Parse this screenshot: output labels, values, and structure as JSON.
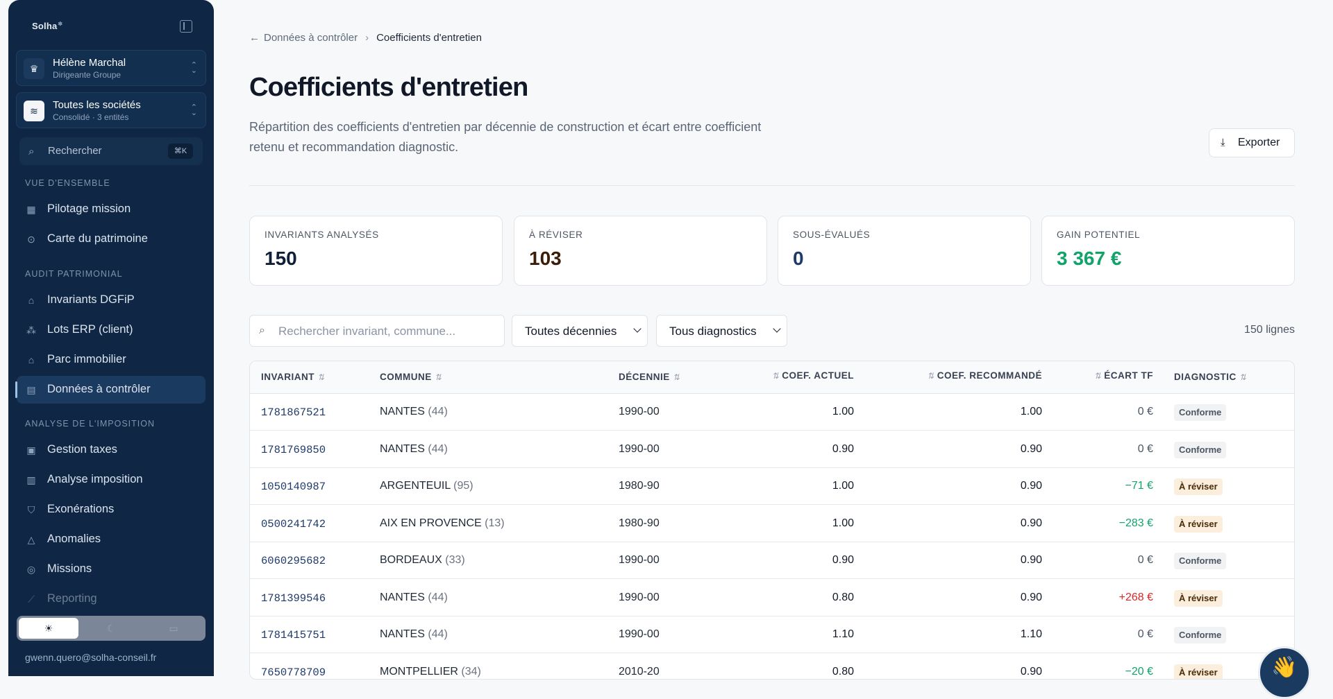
{
  "sidebar": {
    "logo": "Solha",
    "user": {
      "name": "Hélène Marchal",
      "role": "Dirigeante Groupe"
    },
    "company": {
      "name": "Toutes les sociétés",
      "sub": "Consolidé · 3 entités"
    },
    "search": {
      "placeholder": "Rechercher",
      "shortcut": "⌘K"
    },
    "sections": [
      {
        "title": "Vue d'ensemble",
        "items": [
          {
            "label": "Pilotage mission"
          },
          {
            "label": "Carte du patrimoine"
          }
        ]
      },
      {
        "title": "Audit patrimonial",
        "items": [
          {
            "label": "Invariants DGFiP"
          },
          {
            "label": "Lots ERP (client)"
          },
          {
            "label": "Parc immobilier"
          },
          {
            "label": "Données à contrôler"
          }
        ]
      },
      {
        "title": "Analyse de l'imposition",
        "items": [
          {
            "label": "Gestion taxes"
          },
          {
            "label": "Analyse imposition"
          },
          {
            "label": "Exonérations"
          },
          {
            "label": "Anomalies"
          },
          {
            "label": "Missions"
          },
          {
            "label": "Reporting"
          }
        ]
      }
    ],
    "email": "gwenn.quero@solha-conseil.fr"
  },
  "breadcrumb": {
    "back": "Données à contrôler",
    "current": "Coefficients d'entretien"
  },
  "page": {
    "title": "Coefficients d'entretien",
    "description": "Répartition des coefficients d'entretien par décennie de construction et écart entre coefficient retenu et recommandation diagnostic.",
    "export_label": "Exporter"
  },
  "kpis": [
    {
      "label": "Invariants analysés",
      "value": "150",
      "color": "#0f1f38"
    },
    {
      "label": "À réviser",
      "value": "103",
      "color": "#3b1d0a"
    },
    {
      "label": "Sous-évalués",
      "value": "0",
      "color": "#1e3a6b"
    },
    {
      "label": "Gain potentiel",
      "value": "3 367 €",
      "color": "#10a36a"
    }
  ],
  "filters": {
    "search_placeholder": "Rechercher invariant, commune...",
    "decade": "Toutes décennies",
    "diagnostic": "Tous diagnostics",
    "row_count": "150 lignes"
  },
  "table": {
    "columns": [
      "Invariant",
      "Commune",
      "Décennie",
      "Coef. actuel",
      "Coef. recommandé",
      "Écart TF",
      "Diagnostic"
    ],
    "rows": [
      {
        "invariant": "1781867521",
        "commune": "NANTES",
        "dept": "(44)",
        "decade": "1990-00",
        "actual": "1.00",
        "recommended": "1.00",
        "gap": "0 €",
        "gap_kind": "zero",
        "diagnostic": "Conforme"
      },
      {
        "invariant": "1781769850",
        "commune": "NANTES",
        "dept": "(44)",
        "decade": "1990-00",
        "actual": "0.90",
        "recommended": "0.90",
        "gap": "0 €",
        "gap_kind": "zero",
        "diagnostic": "Conforme"
      },
      {
        "invariant": "1050140987",
        "commune": "ARGENTEUIL",
        "dept": "(95)",
        "decade": "1980-90",
        "actual": "1.00",
        "recommended": "0.90",
        "gap": "−71 €",
        "gap_kind": "neg",
        "diagnostic": "À réviser"
      },
      {
        "invariant": "0500241742",
        "commune": "AIX EN PROVENCE",
        "dept": "(13)",
        "decade": "1980-90",
        "actual": "1.00",
        "recommended": "0.90",
        "gap": "−283 €",
        "gap_kind": "neg",
        "diagnostic": "À réviser"
      },
      {
        "invariant": "6060295682",
        "commune": "BORDEAUX",
        "dept": "(33)",
        "decade": "1990-00",
        "actual": "0.90",
        "recommended": "0.90",
        "gap": "0 €",
        "gap_kind": "zero",
        "diagnostic": "Conforme"
      },
      {
        "invariant": "1781399546",
        "commune": "NANTES",
        "dept": "(44)",
        "decade": "1990-00",
        "actual": "0.80",
        "recommended": "0.90",
        "gap": "+268 €",
        "gap_kind": "pos",
        "diagnostic": "À réviser"
      },
      {
        "invariant": "1781415751",
        "commune": "NANTES",
        "dept": "(44)",
        "decade": "1990-00",
        "actual": "1.10",
        "recommended": "1.10",
        "gap": "0 €",
        "gap_kind": "zero",
        "diagnostic": "Conforme"
      },
      {
        "invariant": "7650778709",
        "commune": "MONTPELLIER",
        "dept": "(34)",
        "decade": "2010-20",
        "actual": "0.80",
        "recommended": "0.90",
        "gap": "−20 €",
        "gap_kind": "neg",
        "diagnostic": "À réviser"
      }
    ]
  }
}
